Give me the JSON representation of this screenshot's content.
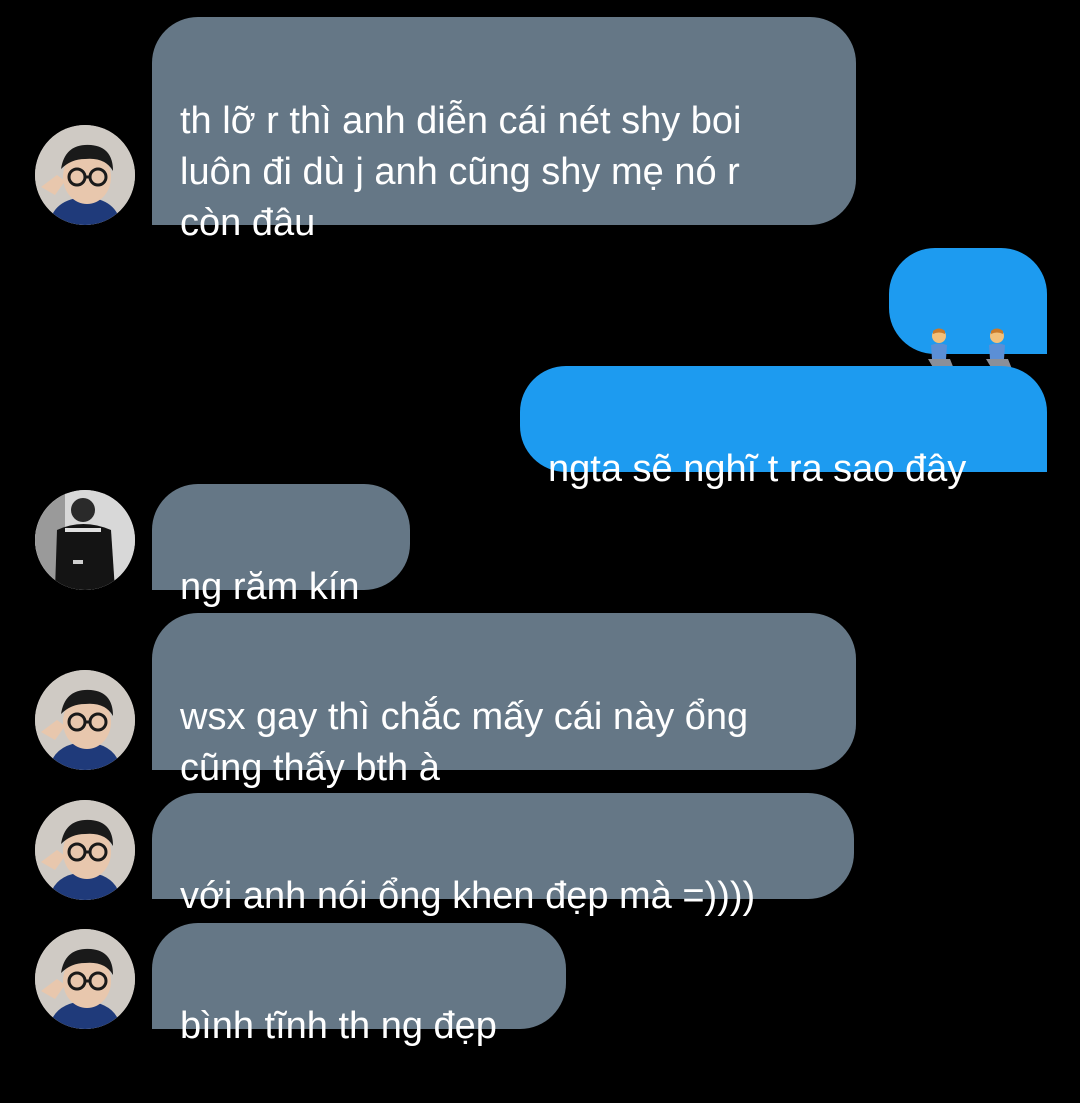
{
  "colors": {
    "background": "#000000",
    "incoming_bubble": "#657786",
    "outgoing_bubble": "#1d9bf0",
    "text": "#ffffff"
  },
  "messages": [
    {
      "direction": "incoming",
      "avatar": "glasses-guy-avatar",
      "text": "th lỡ r thì anh diễn cái nét shy boi\nluôn đi dù j anh cũng shy mẹ nó r\ncòn đâu"
    },
    {
      "direction": "outgoing",
      "icon": "man-kneeling-emoji",
      "count": 2
    },
    {
      "direction": "outgoing",
      "text": "ngta sẽ nghĩ t ra sao đây"
    },
    {
      "direction": "incoming",
      "avatar": "dark-jersey-avatar",
      "text": "ng răm kín"
    },
    {
      "direction": "incoming",
      "avatar": "glasses-guy-avatar",
      "text": "wsx gay thì chắc mấy cái này ổng\ncũng thấy bth à"
    },
    {
      "direction": "incoming",
      "avatar": "glasses-guy-avatar",
      "text": "với anh nói ổng khen đẹp mà =))))"
    },
    {
      "direction": "incoming",
      "avatar": "glasses-guy-avatar",
      "text": "bình tĩnh th ng đẹp"
    }
  ]
}
